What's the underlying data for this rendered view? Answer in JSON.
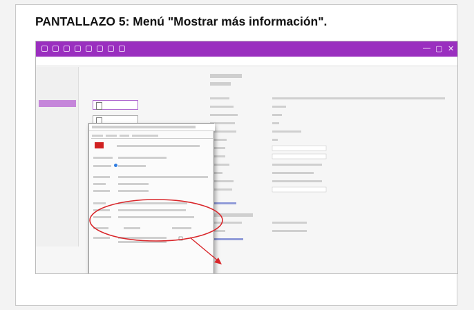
{
  "heading": "PANTALLAZO 5: Menú \"Mostrar más información\".",
  "colors": {
    "accent": "#9a2fbf",
    "nav_active": "#c586da",
    "annotation": "#d9262a",
    "taskbar": "#1c2f4a",
    "link": "#5a6bc8"
  },
  "window": {
    "title_controls": [
      "—",
      "▢",
      "✕"
    ]
  }
}
